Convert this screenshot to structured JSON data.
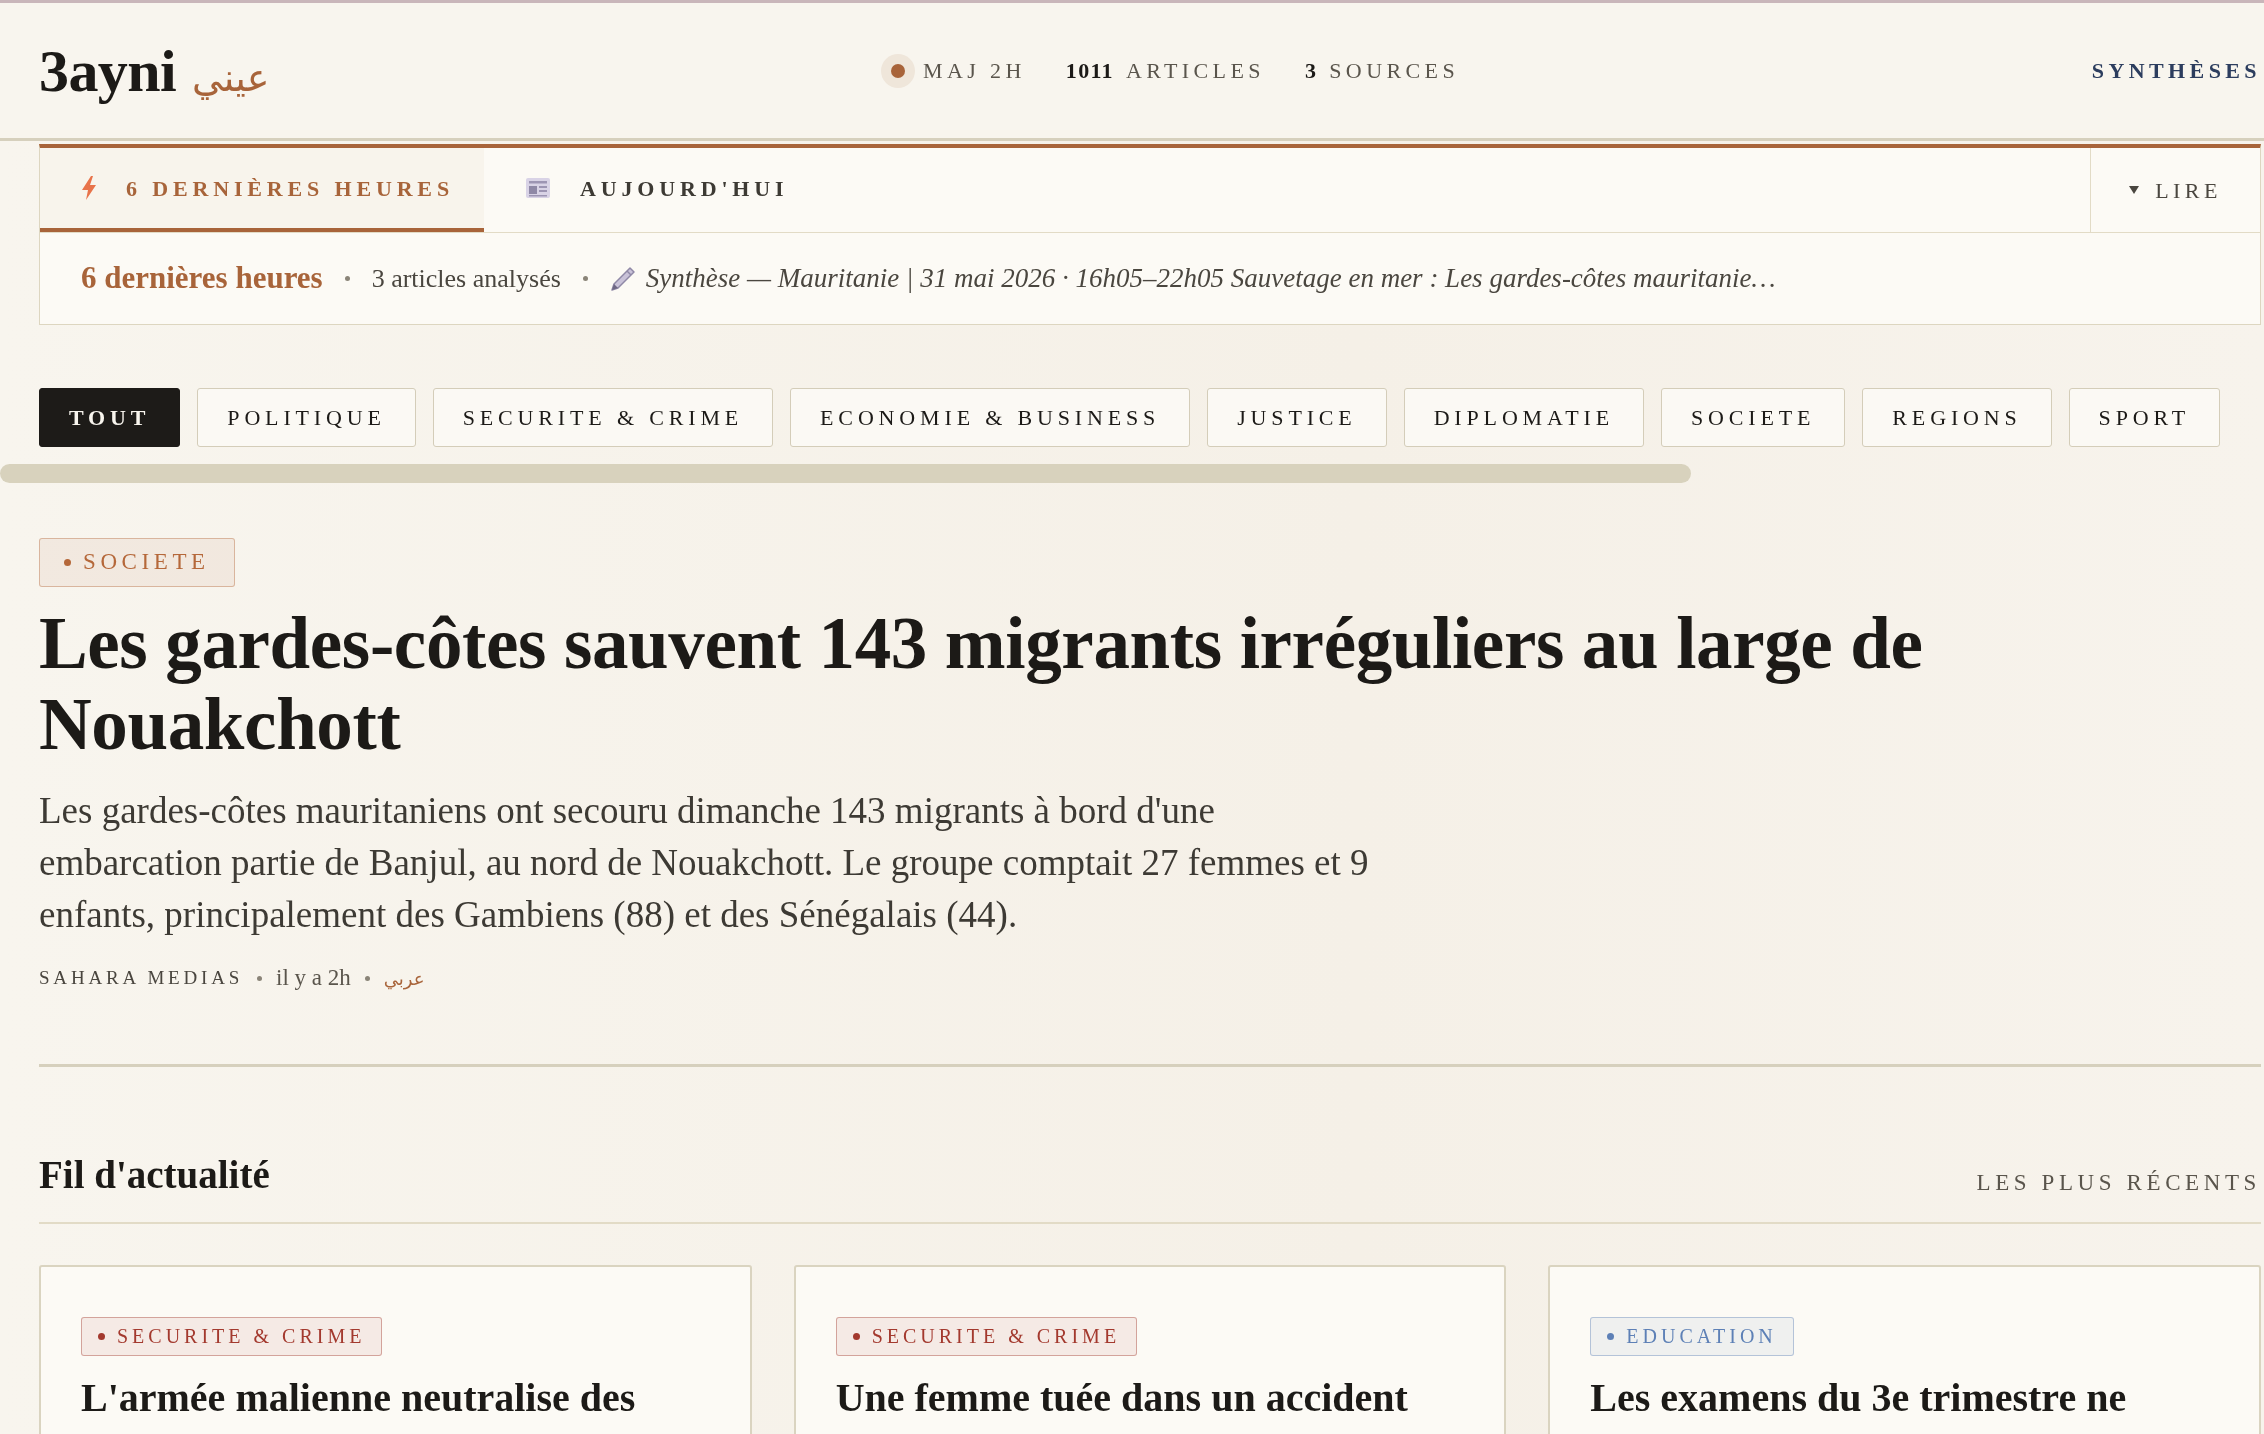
{
  "header": {
    "logo": "3ayni",
    "logo_arabic": "عيني",
    "stats": [
      {
        "kind": "status",
        "label": "MAJ 2H"
      },
      {
        "kind": "count",
        "value": "1011",
        "label": "ARTICLES"
      },
      {
        "kind": "count",
        "value": "3",
        "label": "SOURCES"
      }
    ],
    "nav_link": "SYNTHÈSES"
  },
  "digest": {
    "tabs": [
      {
        "label": "6 DERNIÈRES HEURES",
        "selected": true
      },
      {
        "label": "AUJOURD'HUI",
        "selected": false
      }
    ],
    "toggle": "LIRE",
    "summary": {
      "title": "6 dernières heures",
      "count": "3 articles analysés",
      "excerpt": "Synthèse — Mauritanie | 31 mai 2026 · 16h05–22h05 Sauvetage en mer : Les gardes-côtes mauritanie…"
    }
  },
  "categories": [
    {
      "label": "TOUT",
      "selected": true
    },
    {
      "label": "POLITIQUE",
      "selected": false
    },
    {
      "label": "SECURITE & CRIME",
      "selected": false
    },
    {
      "label": "ECONOMIE & BUSINESS",
      "selected": false
    },
    {
      "label": "JUSTICE",
      "selected": false
    },
    {
      "label": "DIPLOMATIE",
      "selected": false
    },
    {
      "label": "SOCIETE",
      "selected": false
    },
    {
      "label": "REGIONS",
      "selected": false
    },
    {
      "label": "SPORT",
      "selected": false
    }
  ],
  "featured": {
    "tag": {
      "label": "SOCIETE",
      "color": "#b5683a"
    },
    "headline": "Les gardes-côtes sauvent 143 migrants irréguliers au large de Nouakchott",
    "summary": "Les gardes-côtes mauritaniens ont secouru dimanche 143 migrants à bord d'une embarcation partie de Banjul, au nord de Nouakchott. Le groupe comptait 27 femmes et 9 enfants, principalement des Gambiens (88) et des Sénégalais (44).",
    "source": "SAHARA MEDIAS",
    "time": "il y a 2h",
    "language": "عربي"
  },
  "feed": {
    "title": "Fil d'actualité",
    "sort": "LES PLUS RÉCENTS",
    "articles": [
      {
        "tag": {
          "label": "SECURITE & CRIME",
          "color": "#a3392e"
        },
        "title": "L'armée malienne neutralise des"
      },
      {
        "tag": {
          "label": "SECURITE & CRIME",
          "color": "#a3392e"
        },
        "title": "Une femme tuée dans un accident"
      },
      {
        "tag": {
          "label": "EDUCATION",
          "color": "#5d80b6"
        },
        "title": "Les examens du 3e trimestre ne"
      }
    ]
  }
}
